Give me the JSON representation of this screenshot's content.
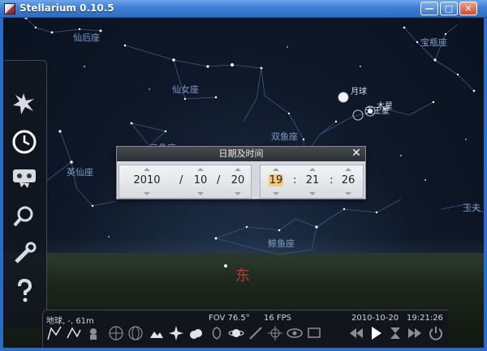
{
  "window": {
    "title": "Stellarium 0.10.5",
    "minimize": "—",
    "maximize": "□",
    "close": "✕"
  },
  "sky": {
    "constellations": [
      {
        "key": "cassiopeia",
        "label": "仙后座"
      },
      {
        "key": "aquarius",
        "label": "宝瓶座"
      },
      {
        "key": "andromeda",
        "label": "仙女座"
      },
      {
        "key": "pisces",
        "label": "双鱼座"
      },
      {
        "key": "triangulum",
        "label": "三角座"
      },
      {
        "key": "perseus",
        "label": "英仙座"
      },
      {
        "key": "cetus",
        "label": "鲸鱼座"
      },
      {
        "key": "sculptor",
        "label": "玉夫"
      }
    ],
    "planets": {
      "moon": "月球",
      "jupiter": "木星",
      "uranus": "天王星"
    },
    "cardinal": "东"
  },
  "left_toolbar": [
    "sky-culture-icon",
    "clock-icon",
    "sky-view-icon",
    "search-icon",
    "configuration-icon",
    "help-icon"
  ],
  "date_dialog": {
    "title": "日期及时间",
    "close": "✕",
    "year": "2010",
    "month": "10",
    "day": "20",
    "hour": "19",
    "minute": "21",
    "second": "26",
    "date_sep": "/",
    "time_sep": ":"
  },
  "status": {
    "location": "地球, -, 61m",
    "fov": "FOV 76.5°",
    "fps": "16 FPS",
    "date": "2010-10-20",
    "time": "19:21:26"
  },
  "colors": {
    "constellation_label": "#7d9ec6",
    "cardinal": "#c0392b",
    "highlight": "#f5c97a",
    "title_bar": "#3d7ed6"
  }
}
